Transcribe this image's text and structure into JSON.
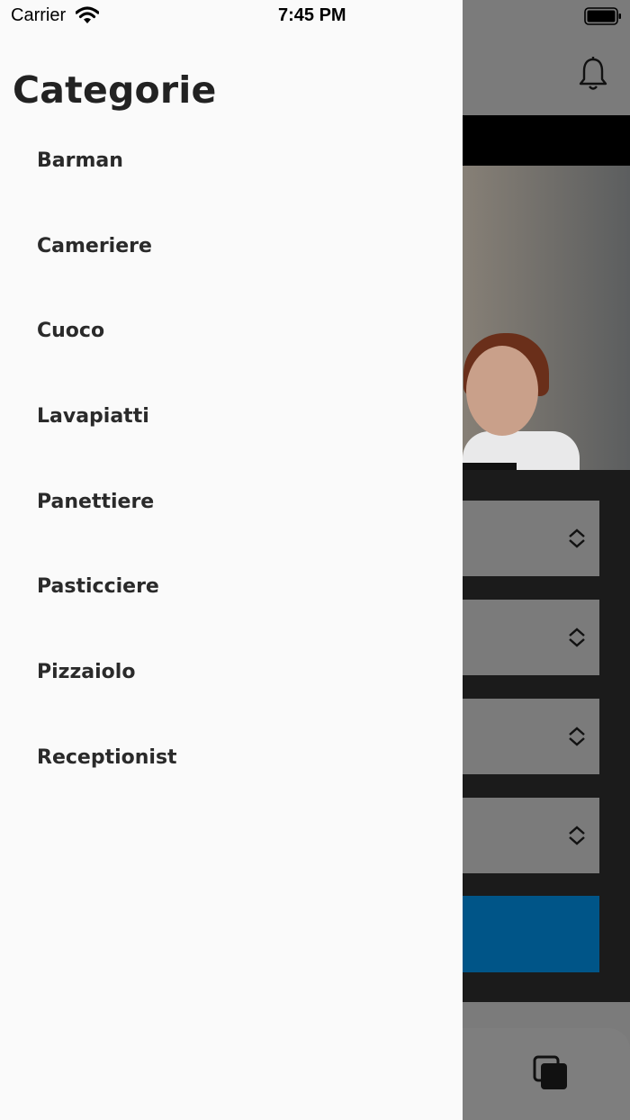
{
  "status_bar": {
    "carrier": "Carrier",
    "time": "7:45 PM"
  },
  "drawer": {
    "title": "Categorie",
    "items": [
      {
        "label": "Barman"
      },
      {
        "label": "Cameriere"
      },
      {
        "label": "Cuoco"
      },
      {
        "label": "Lavapiatti"
      },
      {
        "label": "Panettiere"
      },
      {
        "label": "Pasticciere"
      },
      {
        "label": "Pizzaiolo"
      },
      {
        "label": "Receptionist"
      }
    ]
  },
  "background_app": {
    "header_icon": "bell-icon",
    "dropdown_icon": "chevron-up-down-icon",
    "bottom_nav_icon": "copy-icon",
    "colors": {
      "overlay_gray": "#7b7b7b",
      "cta_blue": "#005588",
      "drawer_bg": "#fafafa"
    }
  }
}
